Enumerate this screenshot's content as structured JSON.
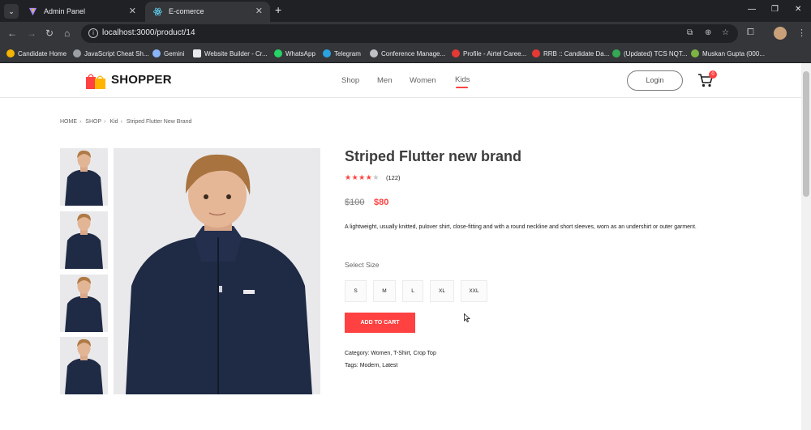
{
  "browser": {
    "tabs": [
      {
        "title": "Admin Panel"
      },
      {
        "title": "E-comerce"
      }
    ],
    "url": "localhost:3000/product/14",
    "bookmarks": [
      {
        "label": "Candidate Home",
        "color": "#f4b400"
      },
      {
        "label": "JavaScript Cheat Sh...",
        "color": "#9aa0a6"
      },
      {
        "label": "Gemini",
        "color": "#8ab4f8"
      },
      {
        "label": "Website Builder - Cr...",
        "color": "#e8eaed"
      },
      {
        "label": "WhatsApp",
        "color": "#25d366"
      },
      {
        "label": "Telegram",
        "color": "#2aa3e0"
      },
      {
        "label": "Conference Manage...",
        "color": "#bdc1c6"
      },
      {
        "label": "Profile - Airtel Caree...",
        "color": "#e53935"
      },
      {
        "label": "RRB :: Candidate Da...",
        "color": "#e53935"
      },
      {
        "label": "(Updated) TCS NQT...",
        "color": "#34a853"
      },
      {
        "label": "Muskan Gupta (000...",
        "color": "#7cb342"
      }
    ]
  },
  "nav": {
    "brand": "SHOPPER",
    "menu": [
      "Shop",
      "Men",
      "Women",
      "Kids"
    ],
    "active_menu": "Kids",
    "login_label": "Login",
    "cart_count": "0"
  },
  "breadcrumb": [
    "HOME",
    "SHOP",
    "Kid",
    "Striped Flutter New Brand"
  ],
  "product": {
    "title": "Striped Flutter new brand",
    "rating": 4,
    "rating_max": 5,
    "reviews": "(122)",
    "old_price": "$100",
    "new_price": "$80",
    "description": "A lightweight, usually knitted, pulover shirt, close-fitting and with a round neckline and short sleeves, worn as an undershirt or outer garment.",
    "size_label": "Select Size",
    "sizes": [
      "S",
      "M",
      "L",
      "XL",
      "XXL"
    ],
    "add_to_cart": "ADD TO CART",
    "category_label": "Category:",
    "category_value": "Women, T-Shirt, Crop Top",
    "tags_label": "Tags:",
    "tags_value": "Modern, Latest"
  },
  "colors": {
    "accent": "#ff4141",
    "jacket": "#1f2a44",
    "image_bg": "#e9e9eb"
  }
}
